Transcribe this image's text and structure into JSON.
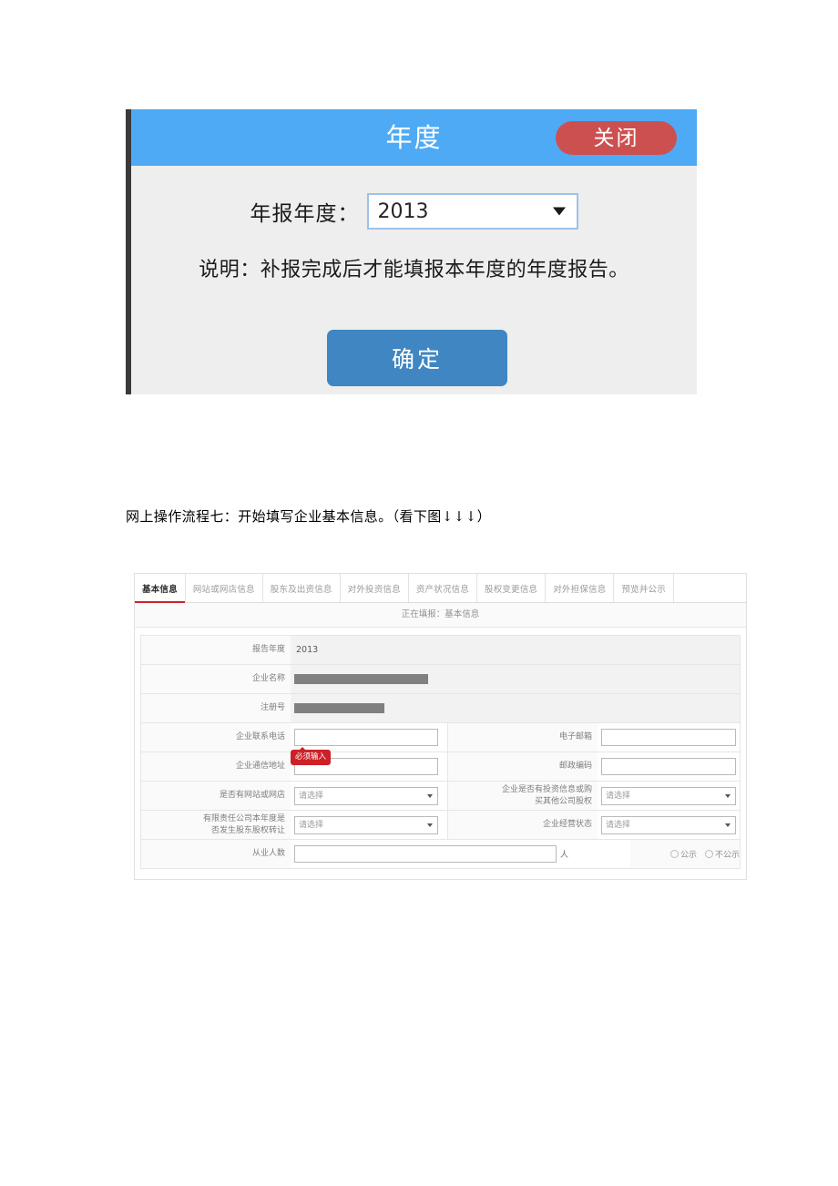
{
  "dialog": {
    "title": "年度",
    "close_label": "关闭",
    "year_label": "年报年度：",
    "year_value": "2013",
    "year_options": [
      "2013"
    ],
    "note": "说明：补报完成后才能填报本年度的年度报告。",
    "confirm_label": "确定",
    "header_color": "#4eaaf5",
    "close_color": "#cd5050",
    "confirm_color": "#3f86c2"
  },
  "caption": "网上操作流程七：开始填写企业基本信息。（看下图↓↓↓）",
  "form": {
    "tabs": [
      {
        "label": "基本信息",
        "active": true
      },
      {
        "label": "网站或网店信息",
        "active": false
      },
      {
        "label": "股东及出资信息",
        "active": false
      },
      {
        "label": "对外投资信息",
        "active": false
      },
      {
        "label": "资产状况信息",
        "active": false
      },
      {
        "label": "股权变更信息",
        "active": false
      },
      {
        "label": "对外担保信息",
        "active": false
      },
      {
        "label": "预览并公示",
        "active": false
      }
    ],
    "filing_status": "正在填报：基本信息",
    "active_tab_underline_color": "#c8242b",
    "rows": {
      "report_year": {
        "label": "报告年度",
        "value": "2013"
      },
      "company_name": {
        "label": "企业名称",
        "value": ""
      },
      "registration_no": {
        "label": "注册号",
        "value": ""
      },
      "phone": {
        "label": "企业联系电话",
        "value": "",
        "placeholder": ""
      },
      "email": {
        "label": "电子邮箱",
        "value": "",
        "placeholder": ""
      },
      "address": {
        "label": "企业通信地址",
        "value": "",
        "placeholder": "",
        "tooltip": "必须输入"
      },
      "postcode": {
        "label": "邮政编码",
        "value": "",
        "placeholder": ""
      },
      "has_website": {
        "label": "是否有网站或网店",
        "value": "请选择"
      },
      "has_investment": {
        "label_line1": "企业是否有投资信息或购",
        "label_line2": "买其他公司股权",
        "value": "请选择"
      },
      "equity_transfer": {
        "label_line1": "有限责任公司本年度是",
        "label_line2": "否发生股东股权转让",
        "value": "请选择"
      },
      "operating_status": {
        "label": "企业经营状态",
        "value": "请选择"
      },
      "employees": {
        "label": "从业人数",
        "value": "",
        "unit": "人"
      }
    },
    "publicity": {
      "public_label": "公示",
      "private_label": "不公示"
    },
    "tooltip_color": "#cc2127"
  }
}
